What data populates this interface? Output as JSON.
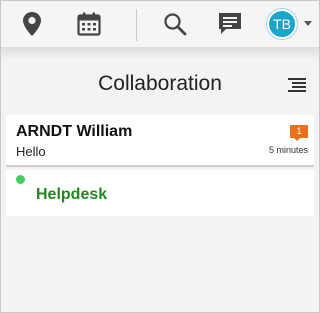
{
  "toolbar": {
    "icons": [
      "map-pin-icon",
      "calendar-icon",
      "search-icon",
      "chat-icon"
    ],
    "avatar_initials": "TB",
    "avatar_color": "#1aa6c9"
  },
  "panel": {
    "title": "Collaboration"
  },
  "conversations": [
    {
      "name": "ARNDT William",
      "message": "Hello",
      "unread": "1",
      "time": "5 minutes"
    }
  ],
  "helpdesk": {
    "label": "Helpdesk",
    "status_color": "#3ecf5e"
  },
  "colors": {
    "badge": "#e8721c",
    "helpdesk_text": "#23881f"
  }
}
